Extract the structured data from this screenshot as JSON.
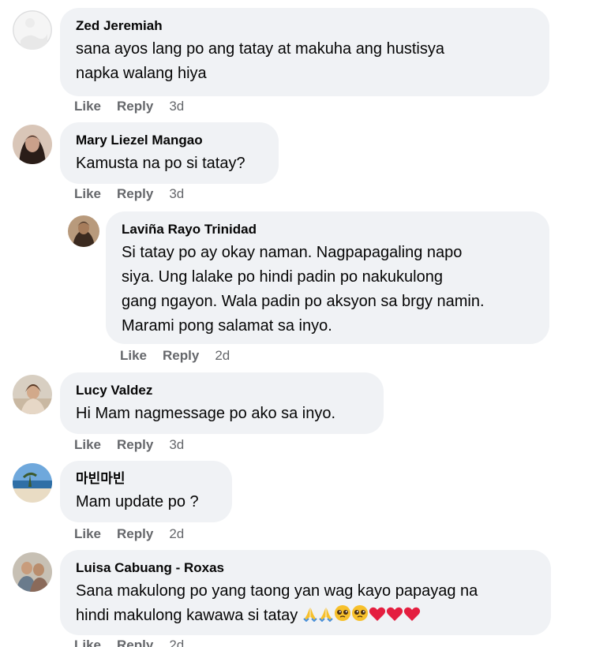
{
  "comments": [
    {
      "author": "Zed Jeremiah",
      "lines": [
        "sana ayos lang po ang tatay at makuha ang hustisya",
        "napka walang hiya"
      ],
      "like": "Like",
      "reply": "Reply",
      "time": "3d"
    },
    {
      "author": "Mary Liezel Mangao",
      "lines": [
        "Kamusta na po si tatay?"
      ],
      "like": "Like",
      "reply": "Reply",
      "time": "3d"
    },
    {
      "author": "Laviña Rayo Trinidad",
      "lines": [
        "Si tatay po ay okay naman. Nagpapagaling napo",
        "siya. Ung lalake po hindi padin po nakukulong",
        "gang ngayon. Wala padin po aksyon sa brgy namin.",
        "Marami pong salamat sa inyo."
      ],
      "like": "Like",
      "reply": "Reply",
      "time": "2d"
    },
    {
      "author": "Lucy Valdez",
      "lines": [
        "Hi Mam nagmessage po ako sa inyo."
      ],
      "like": "Like",
      "reply": "Reply",
      "time": "3d"
    },
    {
      "author": "마빈마빈",
      "lines": [
        "Mam update po ?"
      ],
      "like": "Like",
      "reply": "Reply",
      "time": "2d"
    },
    {
      "author": "Luisa Cabuang - Roxas",
      "lines": [
        "Sana makulong po yang taong yan wag kayo papayag na",
        "hindi makulong kawawa si tatay"
      ],
      "emojis": [
        "praying-hands-icon",
        "praying-hands-icon",
        "pleading-face-icon",
        "pleading-face-icon",
        "red-heart-icon",
        "red-heart-icon",
        "red-heart-icon"
      ],
      "like": "Like",
      "reply": "Reply",
      "time": "2d"
    }
  ],
  "colors": {
    "bubble": "#f0f2f5",
    "meta": "#65676b",
    "text": "#050505",
    "heart": "#e41e3f",
    "emoji_yellow": "#f7c02b",
    "praying_blue": "#4a90d9"
  }
}
